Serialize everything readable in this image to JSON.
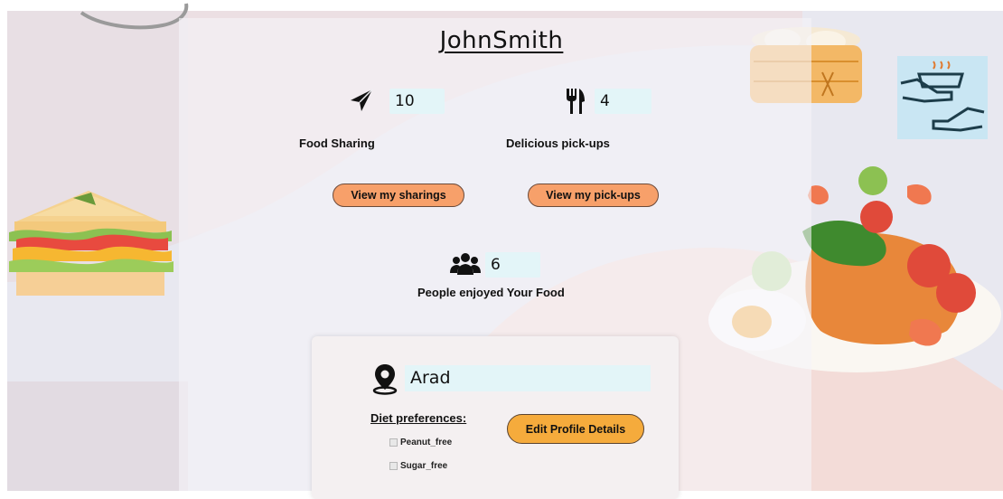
{
  "profile": {
    "username": "JohnSmith",
    "food_sharing": {
      "count": "10",
      "label": "Food Sharing",
      "button": "View my sharings"
    },
    "pickups": {
      "count": "4",
      "label": "Delicious pick-ups",
      "button": "View my pick-ups"
    },
    "people": {
      "count": "6",
      "label": "People enjoyed Your Food"
    }
  },
  "details": {
    "location": "Arad",
    "diet_title": "Diet preferences:",
    "diet_options": [
      "Peanut_free",
      "Sugar_free"
    ],
    "edit_button": "Edit Profile Details"
  },
  "colors": {
    "button_orange": "#f7a06a",
    "edit_button": "#f5ab3c",
    "field_bg": "#e3f5f8"
  },
  "icons": [
    "paper-plane-icon",
    "fork-knife-icon",
    "users-icon",
    "location-pin-icon"
  ]
}
